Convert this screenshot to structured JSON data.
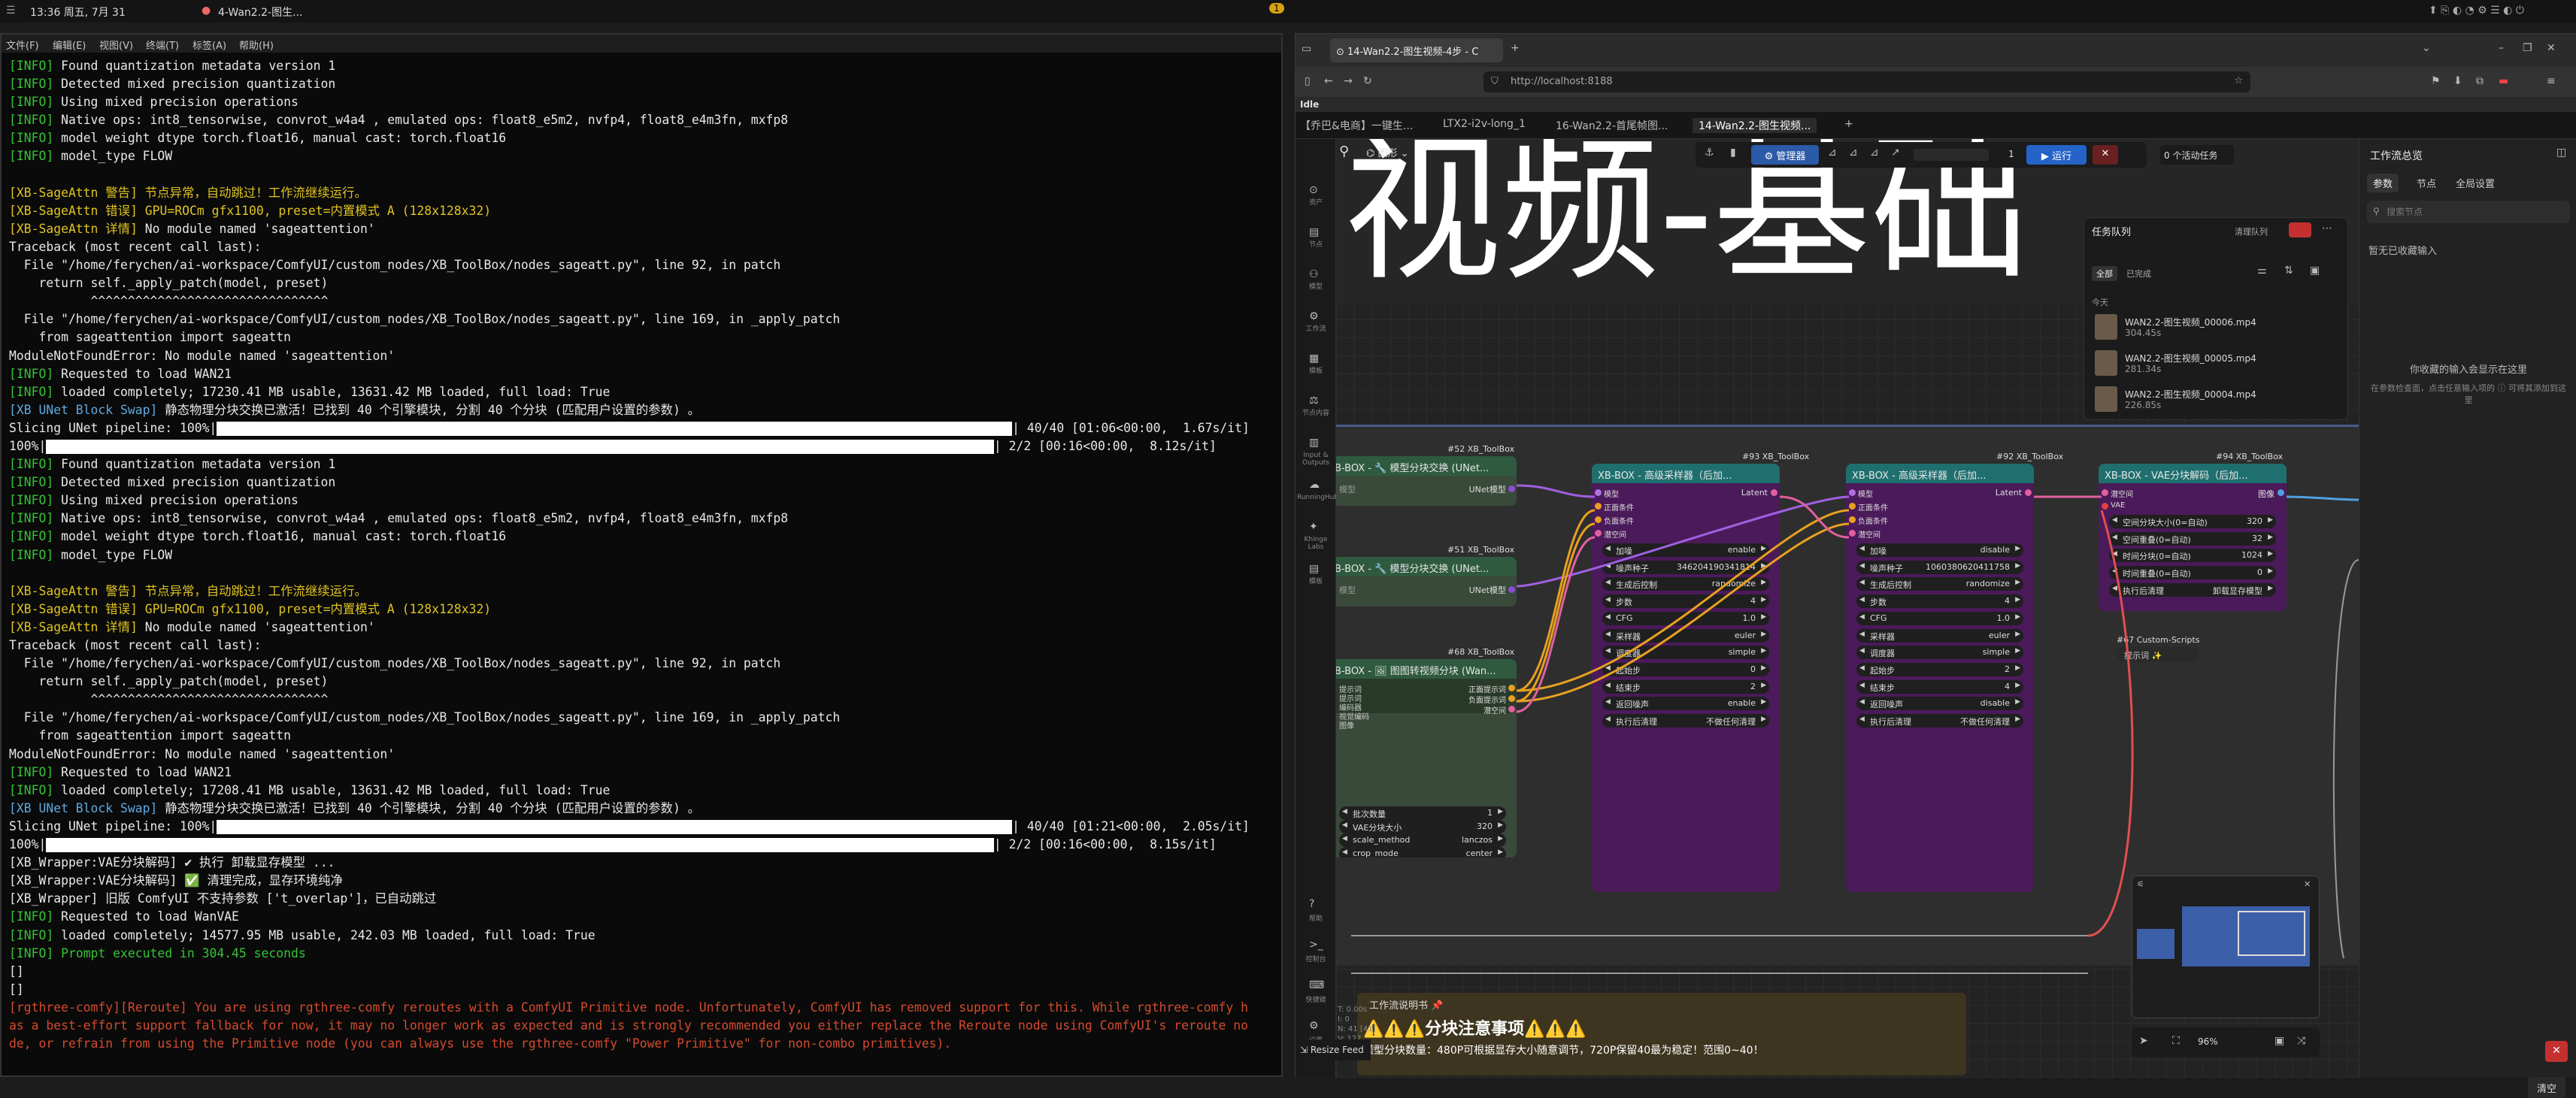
{
  "system_bar": {
    "clock": "13:36 周五, 7月 31",
    "active_window": "4-Wan2.2-图生...",
    "workspace_badge": "1"
  },
  "terminal": {
    "menu": [
      "文件(F)",
      "编辑(E)",
      "视图(V)",
      "终端(T)",
      "标签(A)",
      "帮助(H)"
    ],
    "lines": [
      {
        "prefix": "[INFO]",
        "text": " Found quantization metadata version 1",
        "cls": "info"
      },
      {
        "prefix": "[INFO]",
        "text": " Detected mixed precision quantization",
        "cls": "info"
      },
      {
        "prefix": "[INFO]",
        "text": " Using mixed precision operations",
        "cls": "info"
      },
      {
        "prefix": "[INFO]",
        "text": " Native ops: int8_tensorwise, convrot_w4a4 , emulated ops: float8_e5m2, nvfp4, float8_e4m3fn, mxfp8",
        "cls": "info"
      },
      {
        "prefix": "[INFO]",
        "text": " model weight dtype torch.float16, manual cast: torch.float16",
        "cls": "info"
      },
      {
        "prefix": "[INFO]",
        "text": " model_type FLOW",
        "cls": "info"
      },
      {
        "prefix": "",
        "text": "",
        "cls": ""
      },
      {
        "prefix": "[XB-SageAttn 警告]",
        "text": " 节点异常，自动跳过！工作流继续运行。",
        "cls": "warn",
        "whole": true
      },
      {
        "prefix": "[XB-SageAttn 错误]",
        "text": " GPU=ROCm gfx1100, preset=内置模式 A (128x128x32)",
        "cls": "warn",
        "whole": true
      },
      {
        "prefix": "[XB-SageAttn 详情]",
        "text": " No module named 'sageattention'",
        "cls": "warn"
      },
      {
        "prefix": "",
        "text": "Traceback (most recent call last):",
        "cls": ""
      },
      {
        "prefix": "",
        "text": "  File \"/home/ferychen/ai-workspace/ComfyUI/custom_nodes/XB_ToolBox/nodes_sageatt.py\", line 92, in patch",
        "cls": ""
      },
      {
        "prefix": "",
        "text": "    return self._apply_patch(model, preset)",
        "cls": ""
      },
      {
        "prefix": "",
        "text": "           ^^^^^^^^^^^^^^^^^^^^^^^^^^^^^^^^",
        "cls": ""
      },
      {
        "prefix": "",
        "text": "  File \"/home/ferychen/ai-workspace/ComfyUI/custom_nodes/XB_ToolBox/nodes_sageatt.py\", line 169, in _apply_patch",
        "cls": ""
      },
      {
        "prefix": "",
        "text": "    from sageattention import sageattn",
        "cls": ""
      },
      {
        "prefix": "",
        "text": "ModuleNotFoundError: No module named 'sageattention'",
        "cls": ""
      },
      {
        "prefix": "[INFO]",
        "text": " Requested to load WAN21",
        "cls": "info"
      },
      {
        "prefix": "[INFO]",
        "text": " loaded completely; 17230.41 MB usable, 13631.42 MB loaded, full load: True",
        "cls": "info"
      },
      {
        "prefix": "[XB UNet Block Swap]",
        "text": " 静态物理分块交换已激活！已找到 40 个引擎模块, 分割 40 个分块 (匹配用户设置的参数) 。",
        "cls": "blue"
      },
      {
        "prefix": "",
        "text": "Slicing UNet pipeline: 100%|",
        "bar": 1335,
        "tail": "| 40/40 [01:06<00:00,  1.67s/it]",
        "cls": ""
      },
      {
        "prefix": "",
        "text": "100%|",
        "bar": 1310,
        "tail": "| 2/2 [00:16<00:00,  8.12s/it]",
        "cls": ""
      },
      {
        "prefix": "[INFO]",
        "text": " Found quantization metadata version 1",
        "cls": "info"
      },
      {
        "prefix": "[INFO]",
        "text": " Detected mixed precision quantization",
        "cls": "info"
      },
      {
        "prefix": "[INFO]",
        "text": " Using mixed precision operations",
        "cls": "info"
      },
      {
        "prefix": "[INFO]",
        "text": " Native ops: int8_tensorwise, convrot_w4a4 , emulated ops: float8_e5m2, nvfp4, float8_e4m3fn, mxfp8",
        "cls": "info"
      },
      {
        "prefix": "[INFO]",
        "text": " model weight dtype torch.float16, manual cast: torch.float16",
        "cls": "info"
      },
      {
        "prefix": "[INFO]",
        "text": " model_type FLOW",
        "cls": "info"
      },
      {
        "prefix": "",
        "text": "",
        "cls": ""
      },
      {
        "prefix": "[XB-SageAttn 警告]",
        "text": " 节点异常，自动跳过！工作流继续运行。",
        "cls": "warn",
        "whole": true
      },
      {
        "prefix": "[XB-SageAttn 错误]",
        "text": " GPU=ROCm gfx1100, preset=内置模式 A (128x128x32)",
        "cls": "warn",
        "whole": true
      },
      {
        "prefix": "[XB-SageAttn 详情]",
        "text": " No module named 'sageattention'",
        "cls": "warn"
      },
      {
        "prefix": "",
        "text": "Traceback (most recent call last):",
        "cls": ""
      },
      {
        "prefix": "",
        "text": "  File \"/home/ferychen/ai-workspace/ComfyUI/custom_nodes/XB_ToolBox/nodes_sageatt.py\", line 92, in patch",
        "cls": ""
      },
      {
        "prefix": "",
        "text": "    return self._apply_patch(model, preset)",
        "cls": ""
      },
      {
        "prefix": "",
        "text": "           ^^^^^^^^^^^^^^^^^^^^^^^^^^^^^^^^",
        "cls": ""
      },
      {
        "prefix": "",
        "text": "  File \"/home/ferychen/ai-workspace/ComfyUI/custom_nodes/XB_ToolBox/nodes_sageatt.py\", line 169, in _apply_patch",
        "cls": ""
      },
      {
        "prefix": "",
        "text": "    from sageattention import sageattn",
        "cls": ""
      },
      {
        "prefix": "",
        "text": "ModuleNotFoundError: No module named 'sageattention'",
        "cls": ""
      },
      {
        "prefix": "[INFO]",
        "text": " Requested to load WAN21",
        "cls": "info"
      },
      {
        "prefix": "[INFO]",
        "text": " loaded completely; 17208.41 MB usable, 13631.42 MB loaded, full load: True",
        "cls": "info"
      },
      {
        "prefix": "[XB UNet Block Swap]",
        "text": " 静态物理分块交换已激活！已找到 40 个引擎模块, 分割 40 个分块 (匹配用户设置的参数) 。",
        "cls": "blue"
      },
      {
        "prefix": "",
        "text": "Slicing UNet pipeline: 100%|",
        "bar": 1335,
        "tail": "| 40/40 [01:21<00:00,  2.05s/it]",
        "cls": ""
      },
      {
        "prefix": "",
        "text": "100%|",
        "bar": 1310,
        "tail": "| 2/2 [00:16<00:00,  8.15s/it]",
        "cls": ""
      },
      {
        "prefix": "",
        "text": "[XB_Wrapper:VAE分块解码] ✔ 执行 卸载显存模型 ...",
        "cls": ""
      },
      {
        "prefix": "",
        "text": "[XB_Wrapper:VAE分块解码] ✅ 清理完成，显存环境纯净",
        "cls": ""
      },
      {
        "prefix": "",
        "text": "[XB_Wrapper] 旧版 ComfyUI 不支持参数 ['t_overlap']，已自动跳过",
        "cls": ""
      },
      {
        "prefix": "[INFO]",
        "text": " Requested to load WanVAE",
        "cls": "info"
      },
      {
        "prefix": "[INFO]",
        "text": " loaded completely; 14577.95 MB usable, 242.03 MB loaded, full load: True",
        "cls": "info"
      },
      {
        "prefix": "[INFO]",
        "text": " Prompt executed in 304.45 seconds",
        "cls": "info",
        "whole": true
      },
      {
        "prefix": "",
        "text": "[]",
        "cls": ""
      },
      {
        "prefix": "",
        "text": "[]",
        "cls": ""
      },
      {
        "prefix": "",
        "text": "[rgthree-comfy][Reroute] You are using rgthree-comfy reroutes with a ComfyUI Primitive node. Unfortunately, ComfyUI has removed support for this. While rgthree-comfy h",
        "cls": "red",
        "whole": true
      },
      {
        "prefix": "",
        "text": "as a best-effort support fallback for now, it may no longer work as expected and is strongly recommended you either replace the Reroute node using ComfyUI's reroute no",
        "cls": "red",
        "whole": true
      },
      {
        "prefix": "",
        "text": "de, or refrain from using the Primitive node (you can always use the rgthree-comfy \"Power Primitive\" for non-combo primitives).",
        "cls": "red",
        "whole": true
      }
    ]
  },
  "browser": {
    "active_tab": "14-Wan2.2-图生视频-4步 - C",
    "url": "http://localhost:8188",
    "status": "Idle",
    "workflow_tabs": [
      "【乔巴&电商】一键生...",
      "LTX2-i2v-long_1",
      "16-Wan2.2-首尾帧图...",
      "14-Wan2.2-图生视频..."
    ],
    "canvas_title_text": "视频-基础",
    "toolbar": {
      "graph_label": "图形",
      "manager_label": "管理器",
      "batch_count": "1",
      "run_label": "运行",
      "active_tasks": "0 个活动任务"
    },
    "queue": {
      "title": "任务队列",
      "clear_label": "清理队列",
      "filter_all": "全部",
      "filter_done": "已完成",
      "today": "今天",
      "items": [
        {
          "name": "WAN2.2-图生视频_00006.mp4",
          "time": "304.45s"
        },
        {
          "name": "WAN2.2-图生视频_00005.mp4",
          "time": "281.34s"
        },
        {
          "name": "WAN2.2-图生视频_00004.mp4",
          "time": "226.85s"
        }
      ]
    },
    "left_sidebar": [
      "资产",
      "节点",
      "模型",
      "工作流",
      "模板",
      "节点内容",
      "Input & Outputs",
      "RunningHub",
      "Khinge Labs",
      "模板"
    ],
    "left_sidebar_bottom": [
      "帮助",
      "控制台",
      "快捷键",
      "设置"
    ],
    "right_panel": {
      "title": "工作流总览",
      "tabs": [
        "参数",
        "节点",
        "全局设置"
      ],
      "search_placeholder": "搜索节点",
      "empty_title": "暂无已收藏输入",
      "empty_hint": "你收藏的输入会显示在这里",
      "empty_desc": "在参数检查面，点击任意输入项的 ⓘ 可将其添加到这里"
    },
    "nodes": {
      "n52": {
        "id": "#52 XB_ToolBox",
        "title": "B-BOX - 🔧 模型分块交换 (UNet...",
        "port": "模型",
        "out": "UNet模型"
      },
      "n51": {
        "id": "#51 XB_ToolBox",
        "title": "B-BOX - 🔧 模型分块交换 (UNet...",
        "port": "模型",
        "out": "UNet模型"
      },
      "n68": {
        "id": "#68 XB_ToolBox",
        "title": "B-BOX - 🖼 图图转视频分块 (Wan...",
        "inputs": [
          "提示词",
          "提示词",
          "编码器",
          "视觉编码",
          "图像"
        ],
        "outputs": [
          "正面提示词",
          "负面提示词",
          "潜空间"
        ],
        "rows": [
          {
            "k": "批次数量",
            "v": "1"
          },
          {
            "k": "VAE分块大小",
            "v": "320"
          },
          {
            "k": "scale_method",
            "v": "lanczos"
          },
          {
            "k": "crop_mode",
            "v": "center"
          }
        ]
      },
      "n93": {
        "id": "#93 XB_ToolBox",
        "title": "XB-BOX - 高级采样器（后加...",
        "inputs": [
          "模型",
          "正面条件",
          "负面条件",
          "潜空间"
        ],
        "out": "Latent",
        "rows": [
          {
            "k": "加噪",
            "v": "enable"
          },
          {
            "k": "噪声种子",
            "v": "346204190341814"
          },
          {
            "k": "生成后控制",
            "v": "randomize"
          },
          {
            "k": "步数",
            "v": "4"
          },
          {
            "k": "CFG",
            "v": "1.0"
          },
          {
            "k": "采样器",
            "v": "euler"
          },
          {
            "k": "调度器",
            "v": "simple"
          },
          {
            "k": "起始步",
            "v": "0"
          },
          {
            "k": "结束步",
            "v": "2"
          },
          {
            "k": "返回噪声",
            "v": "enable"
          },
          {
            "k": "执行后清理",
            "v": "不做任何清理"
          }
        ]
      },
      "n92": {
        "id": "#92 XB_ToolBox",
        "title": "XB-BOX - 高级采样器（后加...",
        "inputs": [
          "模型",
          "正面条件",
          "负面条件",
          "潜空间"
        ],
        "out": "Latent",
        "rows": [
          {
            "k": "加噪",
            "v": "disable"
          },
          {
            "k": "噪声种子",
            "v": "1060380620411758"
          },
          {
            "k": "生成后控制",
            "v": "randomize"
          },
          {
            "k": "步数",
            "v": "4"
          },
          {
            "k": "CFG",
            "v": "1.0"
          },
          {
            "k": "采样器",
            "v": "euler"
          },
          {
            "k": "调度器",
            "v": "simple"
          },
          {
            "k": "起始步",
            "v": "2"
          },
          {
            "k": "结束步",
            "v": "4"
          },
          {
            "k": "返回噪声",
            "v": "disable"
          },
          {
            "k": "执行后清理",
            "v": "不做任何清理"
          }
        ]
      },
      "n94": {
        "id": "#94 XB_ToolBox",
        "title": "XB-BOX - VAE分块解码（后加...",
        "inputs": [
          "潜空间",
          "VAE"
        ],
        "out": "图像",
        "rows": [
          {
            "k": "空间分块大小(0=自动)",
            "v": "320"
          },
          {
            "k": "空间重叠(0=自动)",
            "v": "32"
          },
          {
            "k": "时间分块(0=自动)",
            "v": "1024"
          },
          {
            "k": "时间重叠(0=自动)",
            "v": "0"
          },
          {
            "k": "执行后清理",
            "v": "卸载显存模型"
          }
        ]
      },
      "n67": {
        "id": "#67 Custom-Scripts",
        "label": "提示词 ✨"
      }
    },
    "notes": {
      "header": "工作流说明书 📌",
      "title": "⚠️⚠️⚠️分块注意事项⚠️⚠️⚠️",
      "body": "模型分块数量：480P可根据显存大小随意调节，720P保留40最为稳定！范围0~40！"
    },
    "bottom": {
      "zoom": "96%",
      "clear_label": "清空",
      "stats": [
        "T: 0.00s",
        "I: 0",
        "N: 41 [41]",
        "V: 127",
        "FPS: 62.00"
      ],
      "resize_feed": "Resize Feed"
    }
  }
}
